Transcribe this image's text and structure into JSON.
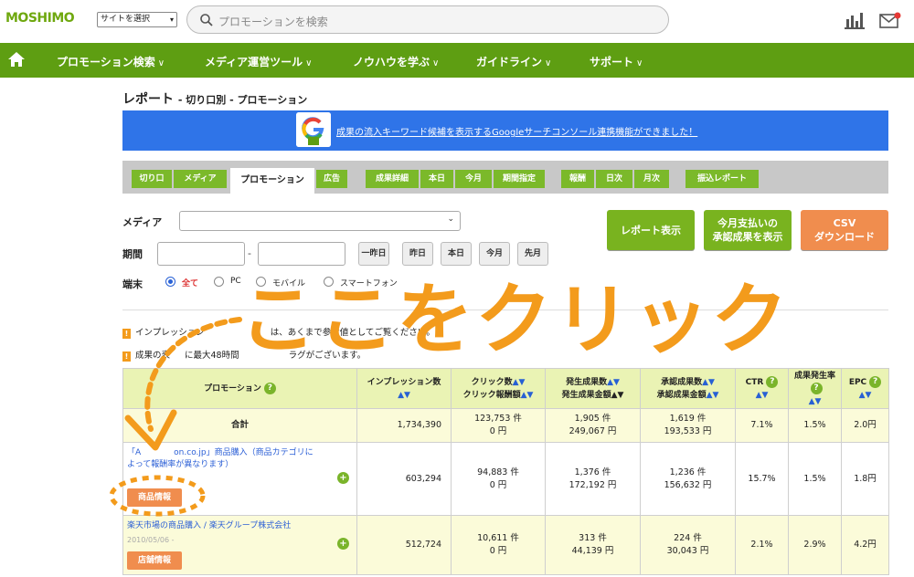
{
  "header": {
    "logo": "MOSHIMO",
    "site_select": "サイトを選択",
    "search_placeholder": "プロモーションを検索"
  },
  "nav": {
    "items": [
      "プロモーション検索",
      "メディア運営ツール",
      "ノウハウを学ぶ",
      "ガイドライン",
      "サポート"
    ]
  },
  "page": {
    "title": "レポート",
    "subtitle": "- 切り口別 - プロモーション"
  },
  "banner": {
    "text": "成果の流入キーワード候補を表示するGoogleサーチコンソール連携機能ができました！"
  },
  "tabs": {
    "group1": [
      "切り口",
      "メディア",
      "プロモーション",
      "広告"
    ],
    "group2": [
      "成果詳細",
      "本日",
      "今月",
      "期間指定"
    ],
    "group3": [
      "報酬",
      "日次",
      "月次"
    ],
    "group4": [
      "振込レポート"
    ]
  },
  "filters": {
    "media_label": "メディア",
    "period_label": "期間",
    "period_sep": "-",
    "quick_buttons": [
      "一昨日",
      "昨日",
      "本日",
      "今月",
      "先月"
    ],
    "device_label": "端末",
    "device_options": [
      "全て",
      "PC",
      "モバイル",
      "スマートフォン"
    ],
    "device_selected": "全て"
  },
  "actions": {
    "report": "レポート表示",
    "approved": "今月支払いの承認成果を表示",
    "approved_l1": "今月支払いの",
    "approved_l2": "承認成果を表示",
    "csv_l1": "CSV",
    "csv_l2": "ダウンロード"
  },
  "notes": [
    "インプレッション数は、あくまで参考値としてご覧ください。",
    "成果の表示に最大48時間のタイムラグがございます。"
  ],
  "notes_visible": [
    "インプレッション",
    "は、あくまで参考値としてご覧ください。",
    "成果の表",
    "に最大48時間",
    "ラグがございます。"
  ],
  "table": {
    "headers": {
      "promotion": "プロモーション",
      "impressions": "インプレッション数",
      "clicks_l1": "クリック数",
      "clicks_l2": "クリック報酬額",
      "generated_l1": "発生成果数",
      "generated_l2": "発生成果金額",
      "approved_l1": "承認成果数",
      "approved_l2": "承認成果金額",
      "ctr": "CTR",
      "cvr": "成果発生率",
      "epc": "EPC"
    },
    "total": {
      "label": "合計",
      "impressions": "1,734,390",
      "clicks": "123,753 件",
      "click_reward": "0 円",
      "generated": "1,905 件",
      "generated_amount": "249,067 円",
      "approved": "1,619 件",
      "approved_amount": "193,533 円",
      "ctr": "7.1%",
      "cvr": "1.5%",
      "epc": "2.0円"
    },
    "rows": [
      {
        "name": "「Amazon.co.jp」商品購入（商品カテゴリによって報酬率が異なります）",
        "name_visible_l1": "「A",
        "name_visible_l2": "on.co.jp」商品購入（商品カテゴリに",
        "name_visible_l3": "よって報酬率が異なります）",
        "date": "",
        "tag": "商品情報",
        "impressions": "603,294",
        "clicks": "94,883 件",
        "click_reward": "0 円",
        "generated": "1,376 件",
        "generated_amount": "172,192 円",
        "approved": "1,236 件",
        "approved_amount": "156,632 円",
        "ctr": "15.7%",
        "cvr": "1.5%",
        "epc": "1.8円"
      },
      {
        "name": "楽天市場の商品購入 / 楽天グループ株式会社",
        "date": "2010/05/06 -",
        "tag": "店舗情報",
        "impressions": "512,724",
        "clicks": "10,611 件",
        "click_reward": "0 円",
        "generated": "313 件",
        "generated_amount": "44,139 円",
        "approved": "224 件",
        "approved_amount": "30,043 円",
        "ctr": "2.1%",
        "cvr": "2.9%",
        "epc": "4.2円"
      }
    ]
  },
  "annotation": {
    "text": "ここをクリック",
    "color": "#f39b1c"
  },
  "colors": {
    "brand_green": "#5e9e12",
    "tab_green": "#7bb92a",
    "action_orange": "#f08d4e",
    "banner_blue": "#2f74e8",
    "table_header": "#eaf3b4",
    "link_blue": "#2b5fd6"
  }
}
